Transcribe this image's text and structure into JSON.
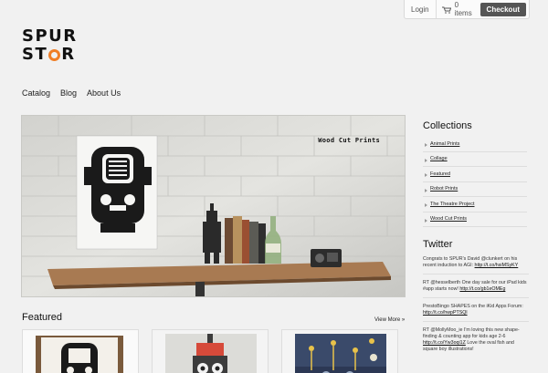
{
  "topbar": {
    "login_label": "Login",
    "cart_icon": "shopping-cart-icon",
    "cart_label": "0 items",
    "checkout_label": "Checkout"
  },
  "logo": {
    "line1": "SPUR",
    "line2_start": "ST",
    "line2_end": "R",
    "accent_color": "#f07e26"
  },
  "nav": {
    "items": [
      "Catalog",
      "Blog",
      "About Us"
    ]
  },
  "hero": {
    "caption": "Wood Cut Prints"
  },
  "collections": {
    "title": "Collections",
    "items": [
      "Animal Prints",
      "Collage",
      "Featured",
      "Robot Prints",
      "The Theatre Project",
      "Wood Cut Prints"
    ]
  },
  "twitter": {
    "title": "Twitter",
    "tweets": [
      {
        "text": "Congrats to SPUR's David @clunkert on his recent induction to AGI:",
        "link": "http://t.co/hsiMSyKY"
      },
      {
        "text": "RT @hesselberth One day sale for our iPad kids #app starts now!",
        "link": "http://t.co/gb1eOMEg"
      },
      {
        "text": "PrestoBingo SHAPES on the iKid Apps Forum:",
        "link": "http://t.co/hwpPTSQl"
      },
      {
        "text": "RT @MollyMoo_ie I'm loving this new shape-finding & counting app for kids age 2-6",
        "link": "http://t.co/Yw3oqi1Z",
        "after": "Love the oval fish and square boy illustrations!"
      }
    ]
  },
  "featured": {
    "title": "Featured",
    "view_more": "View More »"
  }
}
